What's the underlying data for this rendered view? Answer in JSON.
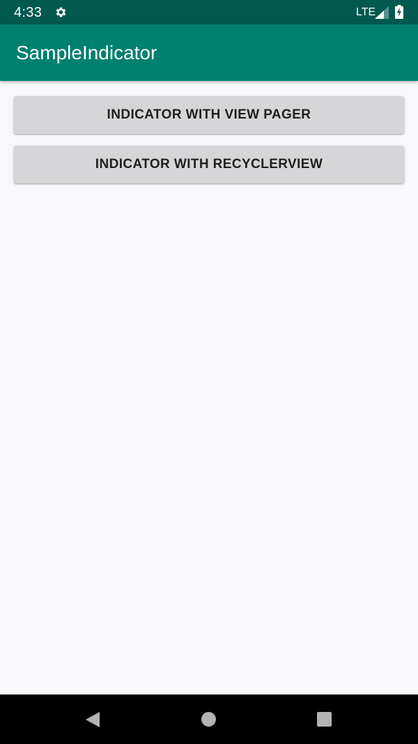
{
  "status_bar": {
    "time": "4:33",
    "network": "LTE",
    "icons": [
      "gear-icon",
      "signal-icon",
      "battery-charging-icon"
    ]
  },
  "app_bar": {
    "title": "SampleIndicator"
  },
  "buttons": {
    "view_pager": "INDICATOR WITH VIEW PAGER",
    "recyclerview": "INDICATOR WITH RECYCLERVIEW"
  },
  "nav_bar": {
    "icons": [
      "back-icon",
      "home-icon",
      "recents-icon"
    ]
  },
  "colors": {
    "status_bar": "#00594f",
    "primary": "#00806f",
    "background": "#f8f7f9",
    "button": "#d6d6d8",
    "nav_bar": "#000000"
  }
}
